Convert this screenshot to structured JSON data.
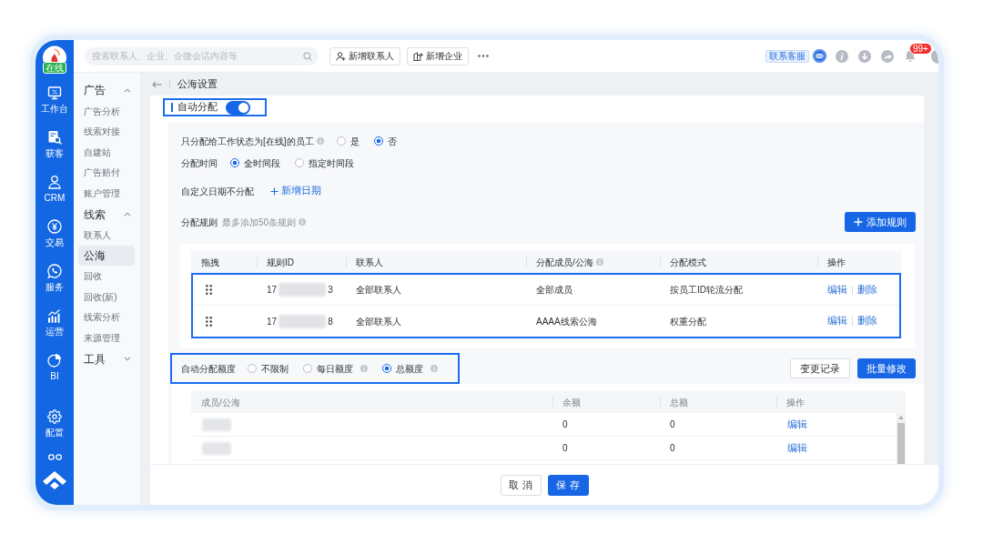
{
  "rail": {
    "status_badge": "在线",
    "items": [
      {
        "label": "工作台"
      },
      {
        "label": "获客"
      },
      {
        "label": "CRM"
      },
      {
        "label": "交易"
      },
      {
        "label": "服务"
      },
      {
        "label": "运营"
      },
      {
        "label": "BI"
      }
    ],
    "bottom_items": [
      {
        "label": "配置"
      }
    ]
  },
  "top_bar": {
    "search": {
      "placeholder": "搜索联系人、企业、企微会话内容等"
    },
    "buttons": [
      {
        "label": "新增联系人"
      },
      {
        "label": "新增企业"
      }
    ],
    "support_label": "联系客服",
    "notification_badge": "99+"
  },
  "sidebar": {
    "groups": [
      {
        "label": "广告",
        "expanded": true,
        "children": [
          {
            "label": "广告分析",
            "selected": false
          },
          {
            "label": "线索对接",
            "selected": false
          },
          {
            "label": "自建站",
            "selected": false
          },
          {
            "label": "广告赔付",
            "selected": false
          },
          {
            "label": "账户管理",
            "selected": false
          }
        ]
      },
      {
        "label": "线索",
        "expanded": true,
        "children": [
          {
            "label": "联系人",
            "selected": false
          },
          {
            "label": "公海",
            "selected": true
          },
          {
            "label": "回收",
            "selected": false
          },
          {
            "label": "回收(新)",
            "selected": false
          },
          {
            "label": "线索分析",
            "selected": false
          },
          {
            "label": "来源管理",
            "selected": false
          }
        ]
      },
      {
        "label": "工具",
        "expanded": false
      }
    ]
  },
  "breadcrumb": {
    "title": "公海设置"
  },
  "auto_assign": {
    "label": "自动分配",
    "on": true,
    "highlighted": true
  },
  "settings": [
    {
      "kind": "radio",
      "label": "只分配给工作状态为[在线]的员工",
      "info": true,
      "options": [
        {
          "label": "是",
          "selected": false
        },
        {
          "label": "否",
          "selected": true
        }
      ]
    },
    {
      "kind": "radio",
      "label": "分配时间",
      "options": [
        {
          "label": "全时间段",
          "selected": true
        },
        {
          "label": "指定时间段",
          "selected": false
        }
      ]
    },
    {
      "kind": "link",
      "label": "自定义日期不分配",
      "link": "新增日期"
    }
  ],
  "rules": {
    "label": "分配规则",
    "hint": "最多添加50条规则",
    "info": true,
    "add_button": "添加规则",
    "columns": [
      {
        "label": "拖拽"
      },
      {
        "label": "规则ID"
      },
      {
        "label": "联系人"
      },
      {
        "label": "分配成员/公海",
        "info": true
      },
      {
        "label": "分配模式"
      },
      {
        "label": "操作"
      }
    ],
    "rows_highlighted": true,
    "rows": [
      {
        "rule_id_start": "17",
        "rule_id_redacted": true,
        "rule_id_end": "3",
        "contacts": "全部联系人",
        "assignee": "全部成员",
        "mode": "按员工ID轮流分配",
        "actions": [
          "编辑",
          "删除"
        ]
      },
      {
        "rule_id_start": "17",
        "rule_id_redacted": true,
        "rule_id_end": "8",
        "contacts": "全部联系人",
        "assignee": "AAAA线索公海",
        "mode": "权重分配",
        "actions": [
          "编辑",
          "删除"
        ]
      }
    ]
  },
  "quota": {
    "label": "自动分配额度",
    "highlighted": true,
    "options": [
      {
        "label": "不限制",
        "selected": false
      },
      {
        "label": "每日额度",
        "selected": false,
        "info": true
      },
      {
        "label": "总额度",
        "selected": true,
        "info": true
      }
    ],
    "buttons": [
      {
        "label": "变更记录",
        "kind": "secondary"
      },
      {
        "label": "批量修改",
        "kind": "primary"
      }
    ],
    "columns": [
      {
        "label": "成员/公海"
      },
      {
        "label": "余额"
      },
      {
        "label": "总额"
      },
      {
        "label": "操作"
      }
    ],
    "rows": [
      {
        "member_redacted": true,
        "balance": "0",
        "total": "0",
        "action": "编辑"
      },
      {
        "member_redacted": true,
        "balance": "0",
        "total": "0",
        "action": "编辑"
      }
    ]
  },
  "footer": {
    "buttons": [
      {
        "label": "取 消",
        "kind": "secondary"
      },
      {
        "label": "保 存",
        "kind": "primary"
      }
    ]
  }
}
